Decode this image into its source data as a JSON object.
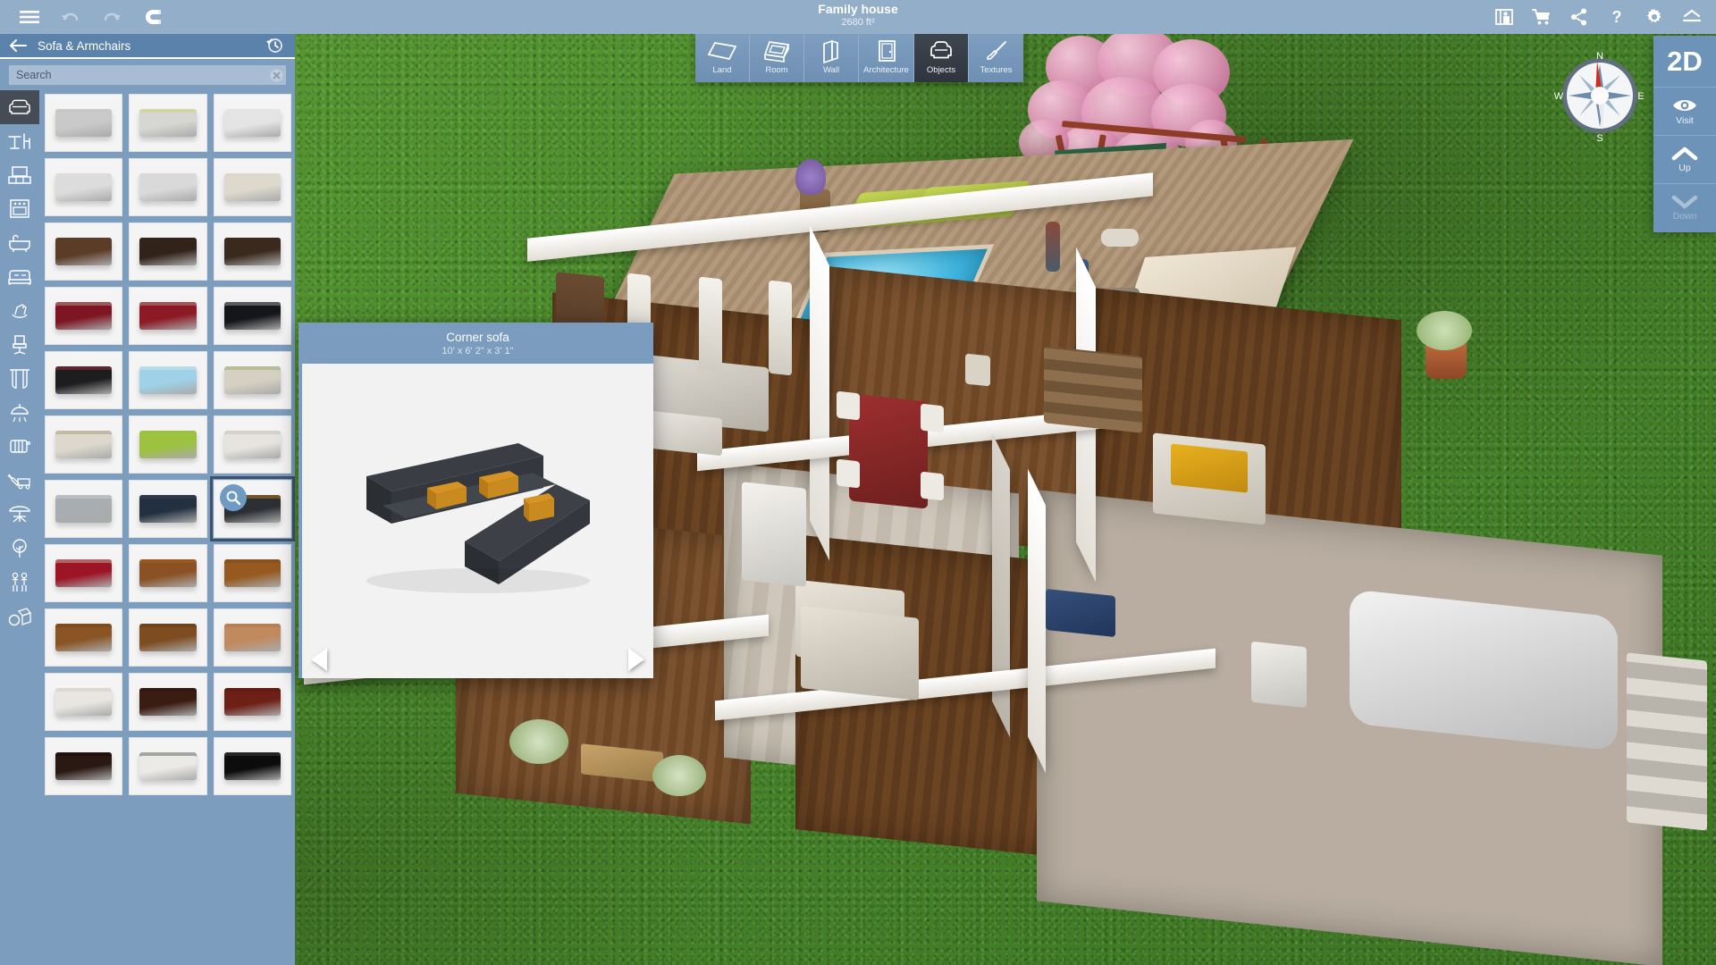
{
  "app": {
    "title": "Family house",
    "area": "2680 ft²"
  },
  "titlebar": {
    "menu_label": "Menu",
    "undo_label": "Undo",
    "redo_label": "Redo",
    "magnet_label": "Magnetism",
    "right_actions": [
      {
        "name": "gallery-icon",
        "label": "Gallery"
      },
      {
        "name": "cart-icon",
        "label": "Cart"
      },
      {
        "name": "share-icon",
        "label": "Share"
      },
      {
        "name": "help-icon",
        "label": "Help"
      },
      {
        "name": "gear-icon",
        "label": "Settings"
      },
      {
        "name": "collapse-icon",
        "label": "Collapse"
      }
    ]
  },
  "modebar": {
    "active": "Objects",
    "tabs": [
      {
        "label": "Land",
        "icon": "land-icon"
      },
      {
        "label": "Room",
        "icon": "room-icon"
      },
      {
        "label": "Wall",
        "icon": "wall-icon"
      },
      {
        "label": "Architecture",
        "icon": "architecture-icon"
      },
      {
        "label": "Objects",
        "icon": "objects-icon"
      },
      {
        "label": "Textures",
        "icon": "textures-icon"
      }
    ]
  },
  "catalog": {
    "title": "Sofa & Armchairs",
    "back_label": "Back",
    "history_label": "History",
    "search": {
      "value": "",
      "placeholder": "Search",
      "clear_label": "Clear search"
    },
    "categories": [
      {
        "name": "sofa",
        "label": "Sofa & Armchairs",
        "active": true
      },
      {
        "name": "tables-chairs",
        "label": "Tables & Chairs",
        "active": false
      },
      {
        "name": "tv-media",
        "label": "TV & Media",
        "active": false
      },
      {
        "name": "kitchen",
        "label": "Kitchen",
        "active": false
      },
      {
        "name": "bathroom",
        "label": "Bathroom",
        "active": false
      },
      {
        "name": "bedroom",
        "label": "Bedroom",
        "active": false
      },
      {
        "name": "kids",
        "label": "Kids",
        "active": false
      },
      {
        "name": "office",
        "label": "Office",
        "active": false
      },
      {
        "name": "curtains",
        "label": "Curtains",
        "active": false
      },
      {
        "name": "lighting",
        "label": "Lighting",
        "active": false
      },
      {
        "name": "heating",
        "label": "Heating",
        "active": false
      },
      {
        "name": "tools-vehicles",
        "label": "Tools & Vehicles",
        "active": false
      },
      {
        "name": "garden",
        "label": "Garden",
        "active": false
      },
      {
        "name": "plants",
        "label": "Plants",
        "active": false
      },
      {
        "name": "people",
        "label": "People",
        "active": false
      },
      {
        "name": "misc",
        "label": "Miscellaneous",
        "active": false
      }
    ],
    "items": [
      {
        "id": 1,
        "color": "#c9c9c9",
        "accent": "",
        "selected": false
      },
      {
        "id": 2,
        "color": "#d6d6d2",
        "accent": "#cfcf6a",
        "selected": false
      },
      {
        "id": 3,
        "color": "#e4e4e4",
        "accent": "",
        "selected": false
      },
      {
        "id": 4,
        "color": "#dcdcdc",
        "accent": "",
        "selected": false
      },
      {
        "id": 5,
        "color": "#d9d9d9",
        "accent": "",
        "selected": false
      },
      {
        "id": 6,
        "color": "#ddd9cc",
        "accent": "",
        "selected": false
      },
      {
        "id": 7,
        "color": "#5a3c27",
        "accent": "",
        "selected": false
      },
      {
        "id": 8,
        "color": "#32231a",
        "accent": "",
        "selected": false
      },
      {
        "id": 9,
        "color": "#3a2a1e",
        "accent": "",
        "selected": false
      },
      {
        "id": 10,
        "color": "#7e1522",
        "accent": "#c8c0b2",
        "selected": false
      },
      {
        "id": 11,
        "color": "#8c1a24",
        "accent": "#b9b2a4",
        "selected": false
      },
      {
        "id": 12,
        "color": "#15161a",
        "accent": "#c2c2c2",
        "selected": false
      },
      {
        "id": 13,
        "color": "#1d1d20",
        "accent": "#b63a4a",
        "selected": false
      },
      {
        "id": 14,
        "color": "#9fd2e8",
        "accent": "#e8e8e8",
        "selected": false
      },
      {
        "id": 15,
        "color": "#d5d0c2",
        "accent": "#8aa15a",
        "selected": false
      },
      {
        "id": 16,
        "color": "#ddd8cc",
        "accent": "#9b8a72",
        "selected": false
      },
      {
        "id": 17,
        "color": "#9cc23f",
        "accent": "",
        "selected": false
      },
      {
        "id": 18,
        "color": "#e6e4de",
        "accent": "#b9b4a8",
        "selected": false
      },
      {
        "id": 19,
        "color": "#a8adb1",
        "accent": "#cfd4d7",
        "selected": false
      },
      {
        "id": 20,
        "color": "#23303f",
        "accent": "#37485c",
        "selected": false
      },
      {
        "id": 21,
        "color": "#2c2f33",
        "accent": "#d98b22",
        "selected": true
      },
      {
        "id": 22,
        "color": "#9c1526",
        "accent": "#ddd6c6",
        "selected": false
      },
      {
        "id": 23,
        "color": "#8a5124",
        "accent": "#a9651f",
        "selected": false
      },
      {
        "id": 24,
        "color": "#96591f",
        "accent": "#7a4719",
        "selected": false
      },
      {
        "id": 25,
        "color": "#8a5424",
        "accent": "#6f4019",
        "selected": false
      },
      {
        "id": 26,
        "color": "#7d4c20",
        "accent": "#5e3717",
        "selected": false
      },
      {
        "id": 27,
        "color": "#c08a5e",
        "accent": "#a87248",
        "selected": false
      },
      {
        "id": 28,
        "color": "#e8e6e1",
        "accent": "#cac6be",
        "selected": false
      },
      {
        "id": 29,
        "color": "#3a1c12",
        "accent": "#2a140d",
        "selected": false
      },
      {
        "id": 30,
        "color": "#6e2016",
        "accent": "#521610",
        "selected": false
      },
      {
        "id": 31,
        "color": "#2a1812",
        "accent": "#150b08",
        "selected": false
      },
      {
        "id": 32,
        "color": "#eceae6",
        "accent": "#3c3c3c",
        "selected": false
      },
      {
        "id": 33,
        "color": "#0c0c0c",
        "accent": "#4a4a4a",
        "selected": false
      }
    ]
  },
  "preview": {
    "title": "Corner sofa",
    "dimensions": "10' x 6' 2\" x 3' 1\"",
    "prev_label": "Previous object",
    "next_label": "Next object",
    "body_color": "#2f3237",
    "cushion_color": "#d89423"
  },
  "viewpanel": {
    "mode_label": "2D",
    "items": [
      {
        "label": "Visit",
        "icon": "eye-icon",
        "disabled": false
      },
      {
        "label": "Up",
        "icon": "chevron-up-icon",
        "disabled": false
      },
      {
        "label": "Down",
        "icon": "chevron-down-icon",
        "disabled": true
      }
    ]
  },
  "compass": {
    "north": "N",
    "east": "E",
    "south": "S",
    "west": "W"
  },
  "colors": {
    "chrome": "#93aec8",
    "panel": "#7d9dbf",
    "header": "#5b82ab",
    "accent_dark": "#3f4650",
    "grass": "#4f8f2f"
  }
}
